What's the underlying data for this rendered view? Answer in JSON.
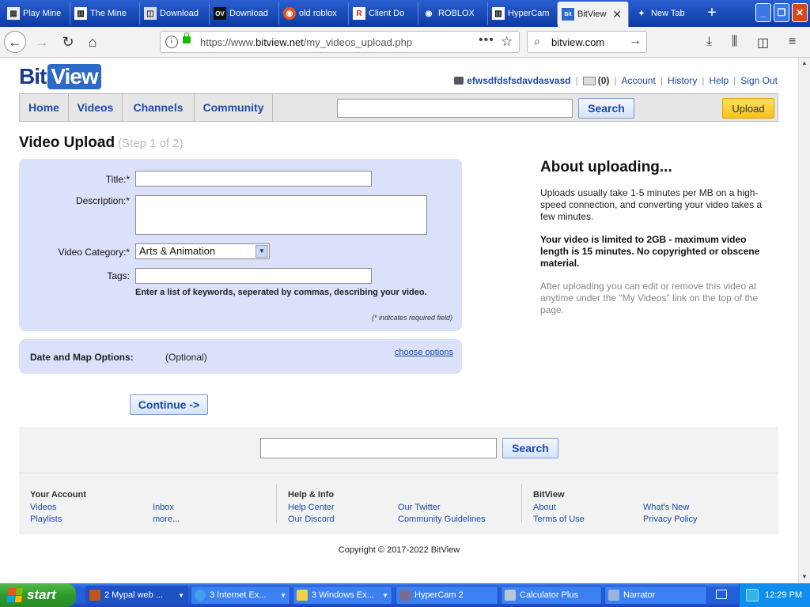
{
  "browser": {
    "tabs": [
      {
        "label": "Play Mine",
        "icon": "tab-icon",
        "color": "#f8f8f8"
      },
      {
        "label": "The Mine",
        "icon": "tab-icon",
        "color": "#f8f8f8"
      },
      {
        "label": "Download",
        "icon": "tab-icon",
        "color": "#f8f8f8"
      },
      {
        "label": "Download",
        "icon": "OV",
        "color": "#f8f8f8"
      },
      {
        "label": "old roblox",
        "icon": "tab-icon",
        "color": "#e8541a"
      },
      {
        "label": "Client Do",
        "icon": "R",
        "color": "#e8541a"
      },
      {
        "label": "ROBLOX",
        "icon": "tab-icon",
        "color": "#f8f8f8"
      },
      {
        "label": "HyperCam",
        "icon": "tab-icon",
        "color": "#f8f8f8"
      },
      {
        "label": "BitView",
        "icon": "Bit",
        "color": "#2b6ac8"
      },
      {
        "label": "New Tab",
        "icon": "tab-icon",
        "color": "#f8f8f8"
      }
    ],
    "url_prefix": "https://www.",
    "url_domain": "bitview.net",
    "url_path": "/my_videos_upload.php",
    "search_value": "bitview.com"
  },
  "site": {
    "logo_bit": "Bit",
    "logo_view": "View",
    "username": "efwsdfdsfsdavdasvasd",
    "inbox_count": "(0)",
    "links": [
      "Account",
      "History",
      "Help",
      "Sign Out"
    ],
    "nav": [
      "Home",
      "Videos",
      "Channels",
      "Community"
    ],
    "search_button": "Search",
    "upload_button": "Upload"
  },
  "upload": {
    "title": "Video Upload",
    "step": "(Step 1 of 2)",
    "title_label": "Title:*",
    "description_label": "Description:*",
    "category_label": "Video Category:*",
    "category_value": "Arts & Animation",
    "tags_label": "Tags:",
    "tags_hint": "Enter a list of keywords, seperated by commas, describing your video.",
    "required_note": "(* indicates required field)",
    "options_label": "Date and Map Options:",
    "options_optional": "(Optional)",
    "options_link": "choose options",
    "continue_button": "Continue ->"
  },
  "about": {
    "heading": "About uploading...",
    "p1": "Uploads usually take 1-5 minutes per MB on a high-speed connection, and converting your video takes a few minutes.",
    "p2": "Your video is limited to 2GB - maximum video length is 15 minutes. No copyrighted or obscene material.",
    "p3": "After uploading you can edit or remove this video at anytime under the \"My Videos\" link on the top of the page."
  },
  "footer": {
    "search_button": "Search",
    "col1_title": "Your Account",
    "col1_links": [
      "Videos",
      "Playlists",
      "Inbox",
      "more..."
    ],
    "col2_title": "Help & Info",
    "col2_links": [
      "Help Center",
      "Our Discord",
      "Our Twitter",
      "Community Guidelines"
    ],
    "col3_title": "BitView",
    "col3_links": [
      "About",
      "Terms of Use",
      "What's New",
      "Privacy Policy"
    ],
    "copyright": "Copyright © 2017-2022 BitView"
  },
  "taskbar": {
    "start": "start",
    "tasks": [
      "2 Mypal web ...",
      "3 Internet Ex...",
      "3 Windows Ex...",
      "HyperCam 2",
      "Calculator Plus",
      "Narrator"
    ],
    "clock": "12:29 PM"
  }
}
